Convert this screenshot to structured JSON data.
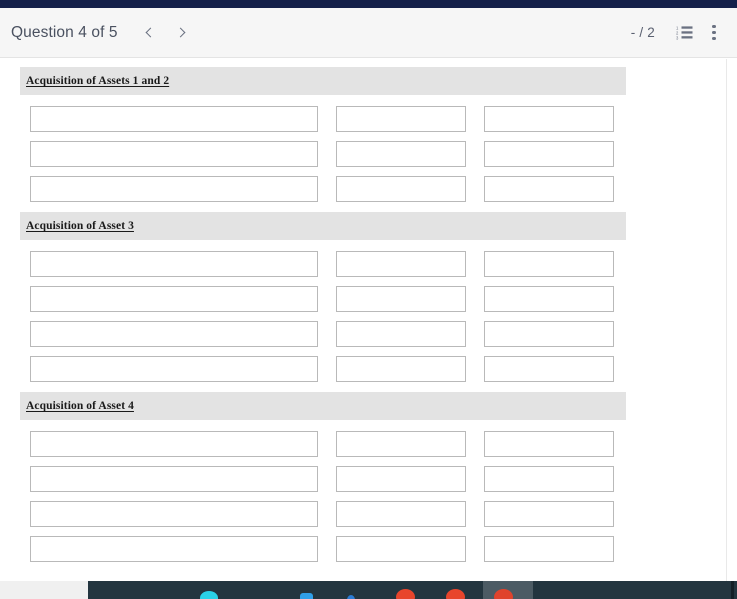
{
  "toolbar": {
    "question_label": "Question 4 of 5",
    "prev_icon": "chevron-left-icon",
    "next_icon": "chevron-right-icon",
    "page_indicator": "- / 2",
    "outline_icon": "outline-list-icon",
    "more_icon": "kebab-menu-icon"
  },
  "colors": {
    "browser_strip": "#14204a",
    "toolbar_bg": "#f6f6f6",
    "section_band": "#e3e3e3",
    "field_border": "#b9b9b9",
    "title_text": "#4a5160",
    "taskbar_dark": "#23353f"
  },
  "document": {
    "sections": [
      {
        "title": "Acquisition of Assets 1 and 2",
        "rows": [
          {
            "fields": [
              {
                "value": "",
                "width": "wide"
              },
              {
                "value": "",
                "width": "narrow"
              },
              {
                "value": "",
                "width": "narrow"
              }
            ]
          },
          {
            "fields": [
              {
                "value": "",
                "width": "wide"
              },
              {
                "value": "",
                "width": "narrow"
              },
              {
                "value": "",
                "width": "narrow"
              }
            ]
          },
          {
            "fields": [
              {
                "value": "",
                "width": "wide"
              },
              {
                "value": "",
                "width": "narrow"
              },
              {
                "value": "",
                "width": "narrow"
              }
            ]
          }
        ]
      },
      {
        "title": "Acquisition of Asset 3",
        "rows": [
          {
            "fields": [
              {
                "value": "",
                "width": "wide"
              },
              {
                "value": "",
                "width": "narrow"
              },
              {
                "value": "",
                "width": "narrow"
              }
            ]
          },
          {
            "fields": [
              {
                "value": "",
                "width": "wide"
              },
              {
                "value": "",
                "width": "narrow"
              },
              {
                "value": "",
                "width": "narrow"
              }
            ]
          },
          {
            "fields": [
              {
                "value": "",
                "width": "wide"
              },
              {
                "value": "",
                "width": "narrow"
              },
              {
                "value": "",
                "width": "narrow"
              }
            ]
          },
          {
            "fields": [
              {
                "value": "",
                "width": "wide"
              },
              {
                "value": "",
                "width": "narrow"
              },
              {
                "value": "",
                "width": "narrow"
              }
            ]
          }
        ]
      },
      {
        "title": "Acquisition of Asset 4",
        "rows": [
          {
            "fields": [
              {
                "value": "",
                "width": "wide"
              },
              {
                "value": "",
                "width": "narrow"
              },
              {
                "value": "",
                "width": "narrow"
              }
            ]
          },
          {
            "fields": [
              {
                "value": "",
                "width": "wide"
              },
              {
                "value": "",
                "width": "narrow"
              },
              {
                "value": "",
                "width": "narrow"
              }
            ]
          },
          {
            "fields": [
              {
                "value": "",
                "width": "wide"
              },
              {
                "value": "",
                "width": "narrow"
              },
              {
                "value": "",
                "width": "narrow"
              }
            ]
          },
          {
            "fields": [
              {
                "value": "",
                "width": "wide"
              },
              {
                "value": "",
                "width": "narrow"
              },
              {
                "value": "",
                "width": "narrow"
              }
            ]
          }
        ]
      }
    ]
  },
  "taskbar": {
    "icons": [
      "app-icon-cyan",
      "app-icon-blue",
      "app-icon-blue-small",
      "app-icon-red",
      "app-icon-red",
      "app-icon-red-active"
    ]
  }
}
